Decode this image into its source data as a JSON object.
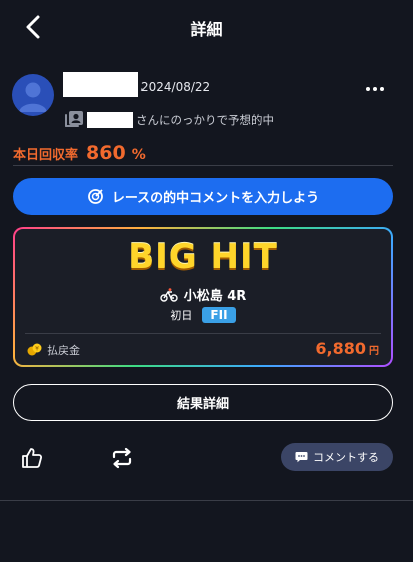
{
  "header": {
    "title": "詳細"
  },
  "post": {
    "date": "2024/08/22",
    "follower_text": "さんにのっかりで予想的中",
    "recovery_label": "本日回収率",
    "recovery_value": "860",
    "recovery_unit": "%"
  },
  "cta": {
    "label": "レースの的中コメントを入力しよう"
  },
  "result_card": {
    "badge": "BIG HIT",
    "venue_race": "小松島 4R",
    "day": "初日",
    "grade": "FII",
    "payout_label": "払戻金",
    "payout_value": "6,880",
    "payout_unit": "円"
  },
  "actions": {
    "result_detail_label": "結果詳細",
    "comment_label": "コメントする"
  },
  "colors": {
    "accent": "#1d6df0",
    "highlight": "#f26a2e",
    "background": "#13161f"
  }
}
